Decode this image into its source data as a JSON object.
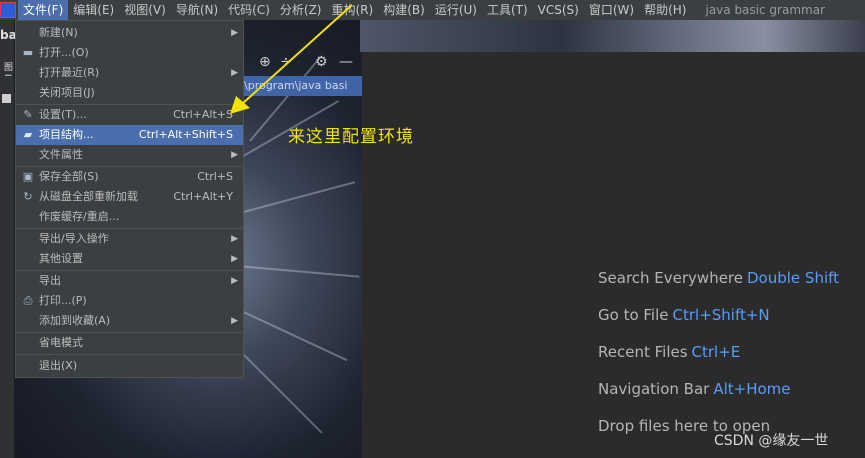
{
  "menubar": {
    "items": [
      "文件(F)",
      "编辑(E)",
      "视图(V)",
      "导航(N)",
      "代码(C)",
      "分析(Z)",
      "重构(R)",
      "构建(B)",
      "运行(U)",
      "工具(T)",
      "VCS(S)",
      "窗口(W)",
      "帮助(H)"
    ],
    "project_title": "java basic grammar"
  },
  "sidebar": {
    "project_label": "ba",
    "vertical_text": "图 I"
  },
  "path_fragment": "\\program\\java basi",
  "file_menu": {
    "items": [
      {
        "label": "新建(N)",
        "shortcut": "",
        "submenu": true,
        "icon": ""
      },
      {
        "label": "打开...(O)",
        "shortcut": "",
        "submenu": false,
        "icon": "folder-open-icon"
      },
      {
        "label": "打开最近(R)",
        "shortcut": "",
        "submenu": true,
        "icon": ""
      },
      {
        "label": "关闭项目(J)",
        "shortcut": "",
        "submenu": false,
        "icon": ""
      },
      {
        "label": "设置(T)...",
        "shortcut": "Ctrl+Alt+S",
        "submenu": false,
        "icon": "wrench-icon"
      },
      {
        "label": "项目结构...",
        "shortcut": "Ctrl+Alt+Shift+S",
        "submenu": false,
        "icon": "project-structure-icon",
        "selected": true
      },
      {
        "label": "文件属性",
        "shortcut": "",
        "submenu": true,
        "icon": ""
      },
      {
        "label": "保存全部(S)",
        "shortcut": "Ctrl+S",
        "submenu": false,
        "icon": "save-icon"
      },
      {
        "label": "从磁盘全部重新加载",
        "shortcut": "Ctrl+Alt+Y",
        "submenu": false,
        "icon": "reload-icon"
      },
      {
        "label": "作废缓存/重启...",
        "shortcut": "",
        "submenu": false,
        "icon": ""
      },
      {
        "label": "导出/导入操作",
        "shortcut": "",
        "submenu": true,
        "icon": ""
      },
      {
        "label": "其他设置",
        "shortcut": "",
        "submenu": true,
        "icon": ""
      },
      {
        "label": "导出",
        "shortcut": "",
        "submenu": true,
        "icon": ""
      },
      {
        "label": "打印...(P)",
        "shortcut": "",
        "submenu": false,
        "icon": "print-icon"
      },
      {
        "label": "添加到收藏(A)",
        "shortcut": "",
        "submenu": true,
        "icon": ""
      },
      {
        "label": "省电模式",
        "shortcut": "",
        "submenu": false,
        "icon": ""
      },
      {
        "label": "退出(X)",
        "shortcut": "",
        "submenu": false,
        "icon": ""
      }
    ]
  },
  "annotation": {
    "text": "来这里配置环境",
    "color": "#f2e200"
  },
  "editor_hints": [
    {
      "label": "Search Everywhere",
      "key": "Double Shift"
    },
    {
      "label": "Go to File",
      "key": "Ctrl+Shift+N"
    },
    {
      "label": "Recent Files",
      "key": "Ctrl+E"
    },
    {
      "label": "Navigation Bar",
      "key": "Alt+Home"
    },
    {
      "label": "Drop files here to open",
      "key": ""
    }
  ],
  "watermark": "CSDN @缘友一世",
  "colors": {
    "accent": "#4b6eaf",
    "link": "#589df6",
    "menu_bg": "#3c3f41",
    "editor_bg": "#2b2b2b"
  }
}
